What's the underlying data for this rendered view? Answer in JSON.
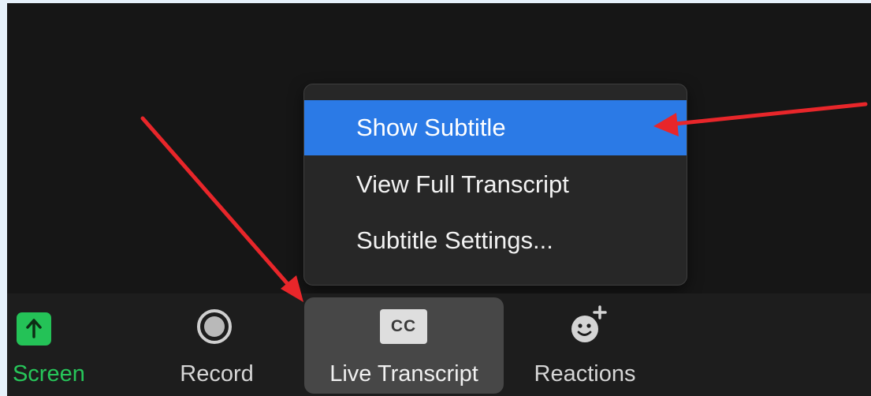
{
  "menu": {
    "items": [
      {
        "label": "Show Subtitle",
        "selected": true
      },
      {
        "label": "View Full Transcript",
        "selected": false
      },
      {
        "label": "Subtitle Settings...",
        "selected": false
      }
    ]
  },
  "toolbar": {
    "share_screen_label": "re Screen",
    "record_label": "Record",
    "live_transcript_label": "Live Transcript",
    "live_transcript_icon_text": "CC",
    "reactions_label": "Reactions"
  },
  "icons": {
    "share": "arrow-up-icon",
    "record": "record-icon",
    "transcript": "cc-icon",
    "reactions": "add-reaction-icon"
  },
  "colors": {
    "background": "#161616",
    "toolbar": "#1d1d1d",
    "menu_background": "#272727",
    "menu_highlight": "#2b7ae6",
    "share_green": "#24c257",
    "annotation_red": "#e8262a"
  }
}
